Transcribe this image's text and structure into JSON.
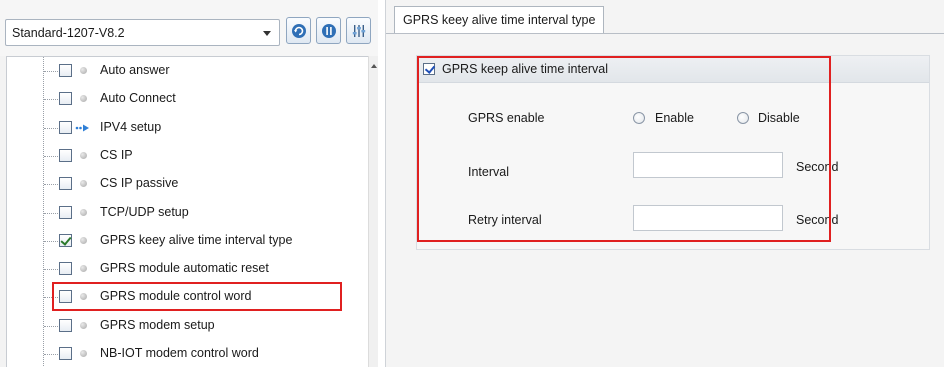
{
  "left": {
    "version_select": "Standard-1207-V8.2",
    "toolbar": {
      "refresh": "refresh-icon",
      "info": "info-icon",
      "settings": "sliders-icon"
    },
    "tree_items": [
      {
        "label": "Auto answer",
        "checked": false,
        "icon": "dot"
      },
      {
        "label": "Auto Connect",
        "checked": false,
        "icon": "dot"
      },
      {
        "label": "IPV4 setup",
        "checked": false,
        "icon": "arrow"
      },
      {
        "label": "CS IP",
        "checked": false,
        "icon": "dot"
      },
      {
        "label": "CS IP passive",
        "checked": false,
        "icon": "dot"
      },
      {
        "label": "TCP/UDP setup",
        "checked": false,
        "icon": "dot"
      },
      {
        "label": "GPRS keey alive time interval type",
        "checked": true,
        "icon": "dot"
      },
      {
        "label": "GPRS module automatic reset",
        "checked": false,
        "icon": "dot"
      },
      {
        "label": "GPRS module control word",
        "checked": false,
        "icon": "dot"
      },
      {
        "label": "GPRS modem setup",
        "checked": false,
        "icon": "dot"
      },
      {
        "label": "NB-IOT modem control word",
        "checked": false,
        "icon": "dot"
      }
    ]
  },
  "right": {
    "tab_title": "GPRS keey alive time interval type",
    "group_title": "GPRS keep alive time interval",
    "gprs_enable": {
      "label": "GPRS enable",
      "options": [
        "Enable",
        "Disable"
      ]
    },
    "interval": {
      "label": "Interval",
      "value": "",
      "unit": "Second"
    },
    "retry_interval": {
      "label": "Retry interval",
      "value": "",
      "unit": "Second"
    }
  },
  "colors": {
    "highlight": "#e02020",
    "panel_bg": "#f4f4f4"
  }
}
